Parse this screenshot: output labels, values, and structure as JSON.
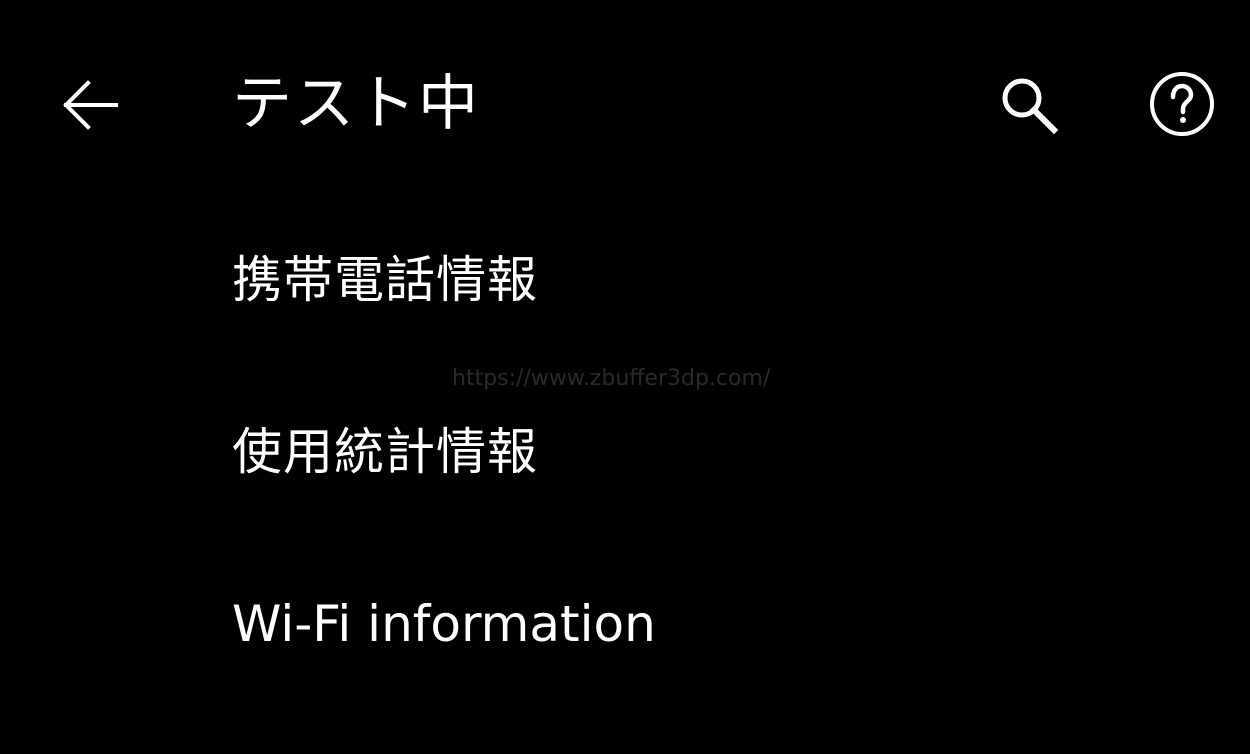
{
  "app_bar": {
    "back_icon": "arrow-back-icon",
    "title": "テスト中",
    "search_icon": "search-icon",
    "help_icon": "help-circle-icon"
  },
  "menu": {
    "items": [
      {
        "label": "携帯電話情報"
      },
      {
        "label": "使用統計情報"
      },
      {
        "label": "Wi-Fi information"
      }
    ]
  },
  "watermark": "https://www.zbuffer3dp.com/",
  "colors": {
    "background": "#000000",
    "text": "#ffffff"
  }
}
